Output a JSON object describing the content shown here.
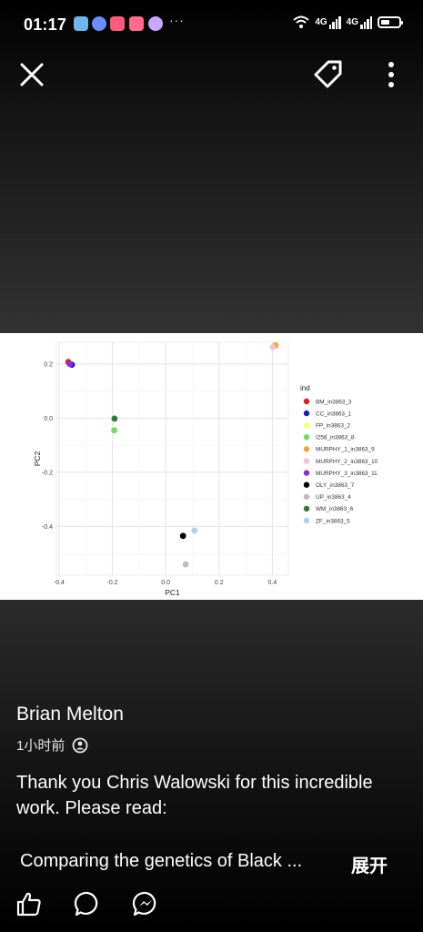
{
  "status_bar": {
    "time": "01:17",
    "more": "···",
    "network_1": "4G",
    "network_2": "4G",
    "notification_icons": [
      "app-icon",
      "message-icon",
      "video-icon",
      "music-icon",
      "assistant-icon"
    ]
  },
  "toolbar": {
    "close_icon": "close-icon",
    "tag_icon": "tag-icon",
    "more_icon": "more-vertical-icon"
  },
  "photo": {
    "chart_data": {
      "type": "scatter",
      "xlabel": "PC1",
      "ylabel": "PC2",
      "x_ticks": [
        "-0.4",
        "-0.2",
        "0.0",
        "0.2",
        "0.4"
      ],
      "y_ticks": [
        "0.2",
        "0.0",
        "-0.2",
        "-0.4"
      ],
      "xlim": [
        -0.41,
        0.46
      ],
      "ylim": [
        -0.58,
        0.28
      ],
      "grid": true,
      "legend_title": "ind",
      "legend_position": "right",
      "series": [
        {
          "name": "BM_in3863_3",
          "color": "#e41a1c",
          "x": -0.365,
          "y": 0.207
        },
        {
          "name": "CC_in3863_1",
          "color": "#1f1fb4",
          "x": -0.352,
          "y": 0.197
        },
        {
          "name": "FP_in3863_2",
          "color": "#ffff66",
          "x": 0.405,
          "y": 0.265
        },
        {
          "name": "I258_in3863_8",
          "color": "#6ee05a",
          "x": -0.193,
          "y": -0.045
        },
        {
          "name": "MURPHY_1_in3863_9",
          "color": "#f0a63a",
          "x": 0.412,
          "y": 0.268
        },
        {
          "name": "MURPHY_2_in3863_10",
          "color": "#f6c0d6",
          "x": 0.402,
          "y": 0.262
        },
        {
          "name": "MURPHY_3_in3863_11",
          "color": "#8a2be2",
          "x": -0.36,
          "y": 0.2
        },
        {
          "name": "OLY_in3863_7",
          "color": "#000000",
          "x": 0.065,
          "y": -0.435
        },
        {
          "name": "UP_in3863_4",
          "color": "#bdbdbd",
          "x": 0.075,
          "y": -0.54
        },
        {
          "name": "WM_in3863_6",
          "color": "#2e7d32",
          "x": -0.192,
          "y": -0.002
        },
        {
          "name": "ZF_in3863_5",
          "color": "#a8d3f0",
          "x": 0.108,
          "y": -0.415
        }
      ]
    }
  },
  "post": {
    "author": "Brian Melton",
    "time_ago": "1小时前",
    "audience_icon": "friends-icon",
    "text": "Thank you Chris Walowski for this incredible work. Please read:",
    "snippet": "Comparing the genetics of Black ...",
    "expand_label": "展开"
  },
  "actions": {
    "like_icon": "like-icon",
    "comment_icon": "comment-icon",
    "share_icon": "messenger-icon"
  }
}
